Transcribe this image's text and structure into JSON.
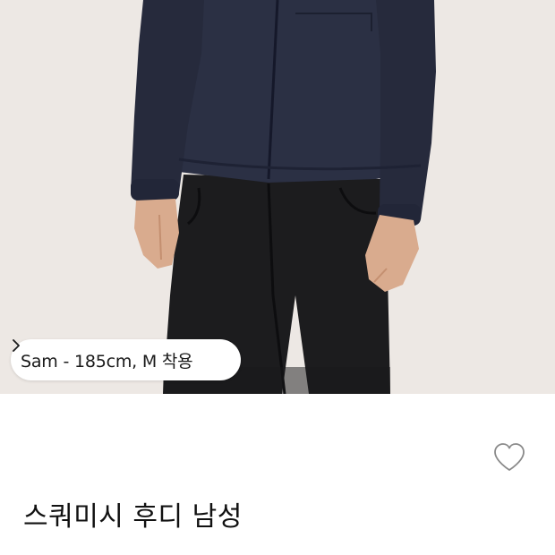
{
  "product": {
    "image_alt": "Squamish Hoody worn by model",
    "model_info": "Sam - 185cm, M 착용",
    "title": "스쿼미시 후디 남성"
  },
  "icons": {
    "chip_chevron": "chevron-right-icon",
    "wishlist": "heart-outline-icon"
  },
  "colors": {
    "background": "#ede8e4",
    "jacket": "#2b3044",
    "pants": "#1c1c1e",
    "skin": "#d9ab8e"
  }
}
